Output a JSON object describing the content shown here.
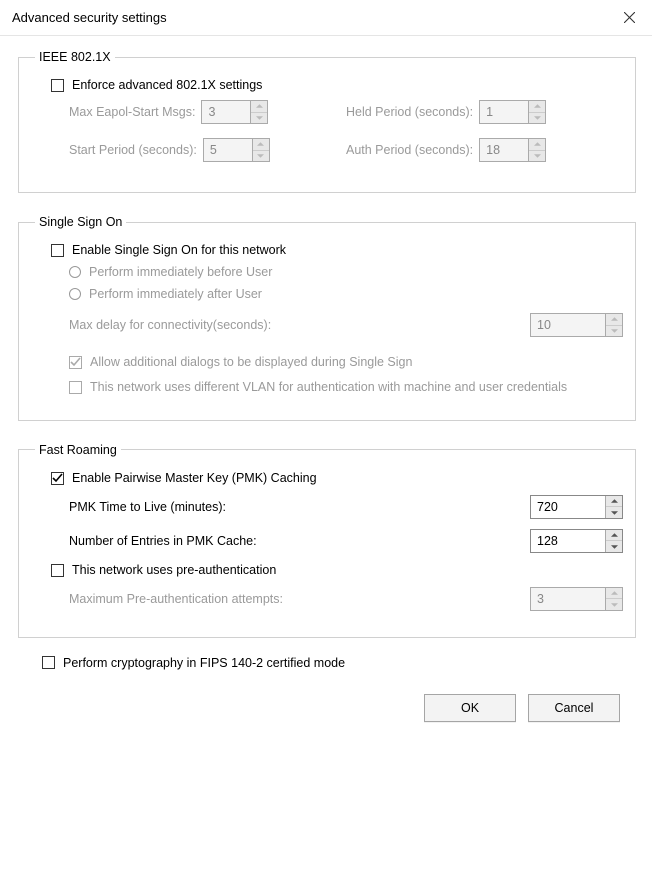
{
  "window": {
    "title": "Advanced security settings"
  },
  "ieee": {
    "legend": "IEEE 802.1X",
    "enforce": {
      "label": "Enforce advanced 802.1X settings",
      "checked": false
    },
    "max_eapol_label": "Max Eapol-Start Msgs:",
    "max_eapol_value": "3",
    "held_label": "Held Period (seconds):",
    "held_value": "1",
    "start_label": "Start Period (seconds):",
    "start_value": "5",
    "auth_label": "Auth Period (seconds):",
    "auth_value": "18"
  },
  "sso": {
    "legend": "Single Sign On",
    "enable": {
      "label": "Enable Single Sign On for this network",
      "checked": false
    },
    "before": "Perform immediately before User",
    "after": "Perform immediately after User",
    "max_delay_label": "Max delay for connectivity(seconds):",
    "max_delay_value": "10",
    "allow_dialogs": {
      "label": "Allow additional dialogs to be displayed during Single Sign",
      "checked": true
    },
    "diff_vlan": {
      "label": "This network uses different VLAN for authentication with machine and user credentials",
      "checked": false
    }
  },
  "roam": {
    "legend": "Fast Roaming",
    "pmk_enable": {
      "label": "Enable Pairwise Master Key (PMK) Caching",
      "checked": true
    },
    "ttl_label": "PMK Time to Live (minutes):",
    "ttl_value": "720",
    "entries_label": "Number of Entries in PMK Cache:",
    "entries_value": "128",
    "preauth": {
      "label": "This network uses pre-authentication",
      "checked": false
    },
    "max_attempts_label": "Maximum Pre-authentication attempts:",
    "max_attempts_value": "3"
  },
  "fips": {
    "label": "Perform cryptography in FIPS 140-2 certified mode",
    "checked": false
  },
  "buttons": {
    "ok": "OK",
    "cancel": "Cancel"
  }
}
